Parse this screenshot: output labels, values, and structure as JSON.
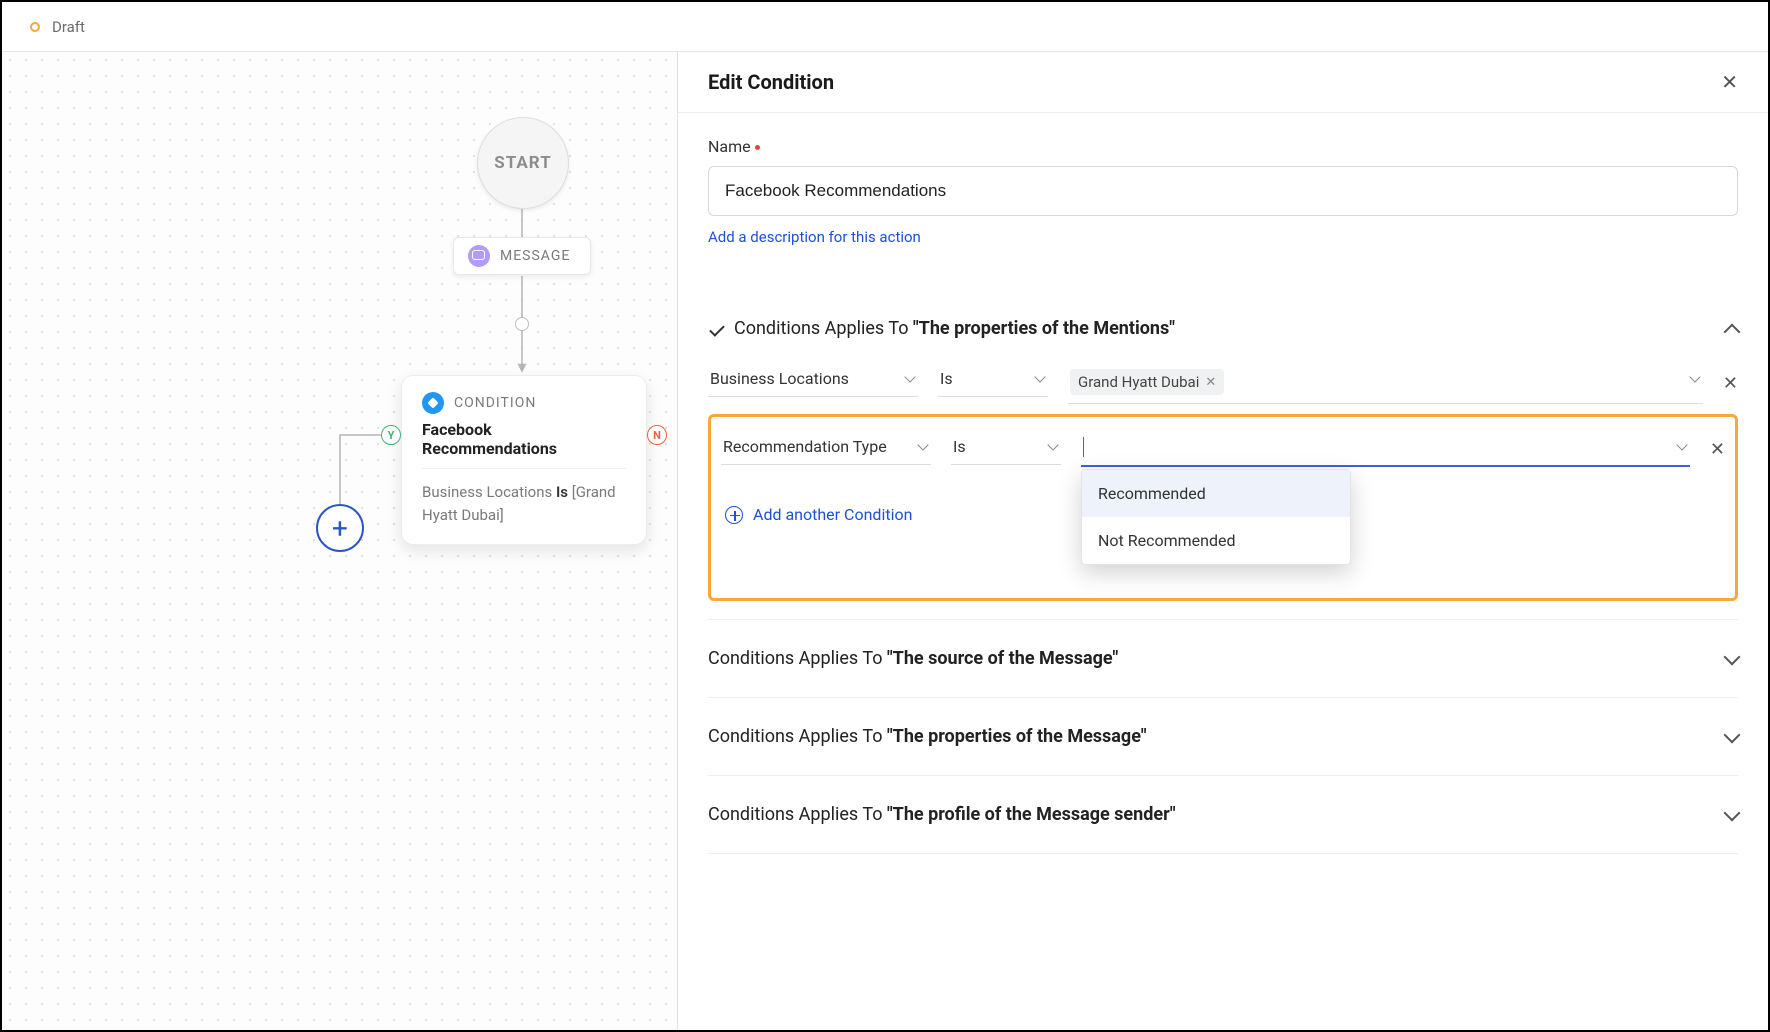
{
  "topbar": {
    "draft": "Draft"
  },
  "canvas": {
    "start": "START",
    "message_label": "MESSAGE",
    "cond_type": "CONDITION",
    "cond_name": "Facebook Recommendations",
    "cond_body_field": "Business Locations",
    "cond_body_op": "Is",
    "cond_body_val": "[Grand Hyatt Dubai]",
    "yes": "Y",
    "no": "N"
  },
  "panel": {
    "title": "Edit Condition",
    "name_label": "Name",
    "name_value": "Facebook Recommendations",
    "desc_link": "Add a description for this action",
    "sections": {
      "mentions": {
        "prefix": "Conditions Applies To",
        "quoted": "\"The properties of the Mentions\""
      },
      "source": {
        "prefix": "Conditions Applies To",
        "quoted": "\"The source of the Message\""
      },
      "msgprops": {
        "prefix": "Conditions Applies To",
        "quoted": "\"The properties of the Message\""
      },
      "sender": {
        "prefix": "Conditions Applies To",
        "quoted": "\"The profile of the Message sender\""
      }
    },
    "rows": [
      {
        "field": "Business Locations",
        "op": "Is",
        "chips": [
          "Grand Hyatt Dubai"
        ]
      },
      {
        "field": "Recommendation Type",
        "op": "Is",
        "chips": []
      }
    ],
    "dropdown": [
      "Recommended",
      "Not Recommended"
    ],
    "add_cond": "Add another Condition"
  }
}
